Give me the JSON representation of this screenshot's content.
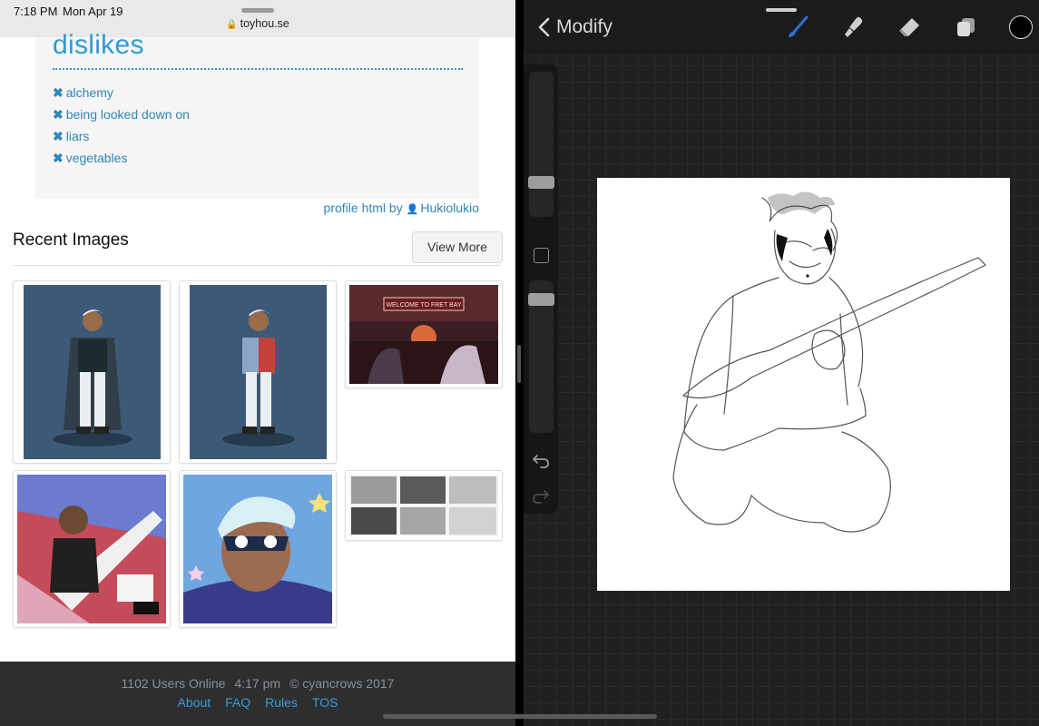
{
  "status_bar": {
    "time": "7:18 PM",
    "date": "Mon Apr 19",
    "url": "toyhou.se"
  },
  "profile": {
    "dislikes_title": "dislikes",
    "dislikes": [
      "alchemy",
      "being looked down on",
      "liars",
      "vegetables"
    ],
    "credit_prefix": "profile html by",
    "credit_user": "Hukiolukio"
  },
  "recent_images": {
    "title": "Recent Images",
    "view_more_label": "View More",
    "items": [
      "character-full-body-cloak",
      "character-full-body-jacket",
      "welcome-to-fret-bay-scene",
      "guitar-illustration",
      "masked-portrait",
      "comic-page"
    ],
    "thumbnail_text": {
      "fret_bay_sign": "WELCOME TO FRET BAY"
    }
  },
  "footer": {
    "users_online": "1102 Users Online",
    "clock": "4:17 pm",
    "copyright": "© cyancrows 2017",
    "links": [
      "About",
      "FAQ",
      "Rules",
      "TOS"
    ]
  },
  "procreate": {
    "mode_label": "Modify",
    "tools": [
      "brush-icon",
      "smudge-icon",
      "eraser-icon",
      "layers-icon",
      "color-icon"
    ],
    "accent_color": "#2f6fd6",
    "current_color": "#000000"
  }
}
